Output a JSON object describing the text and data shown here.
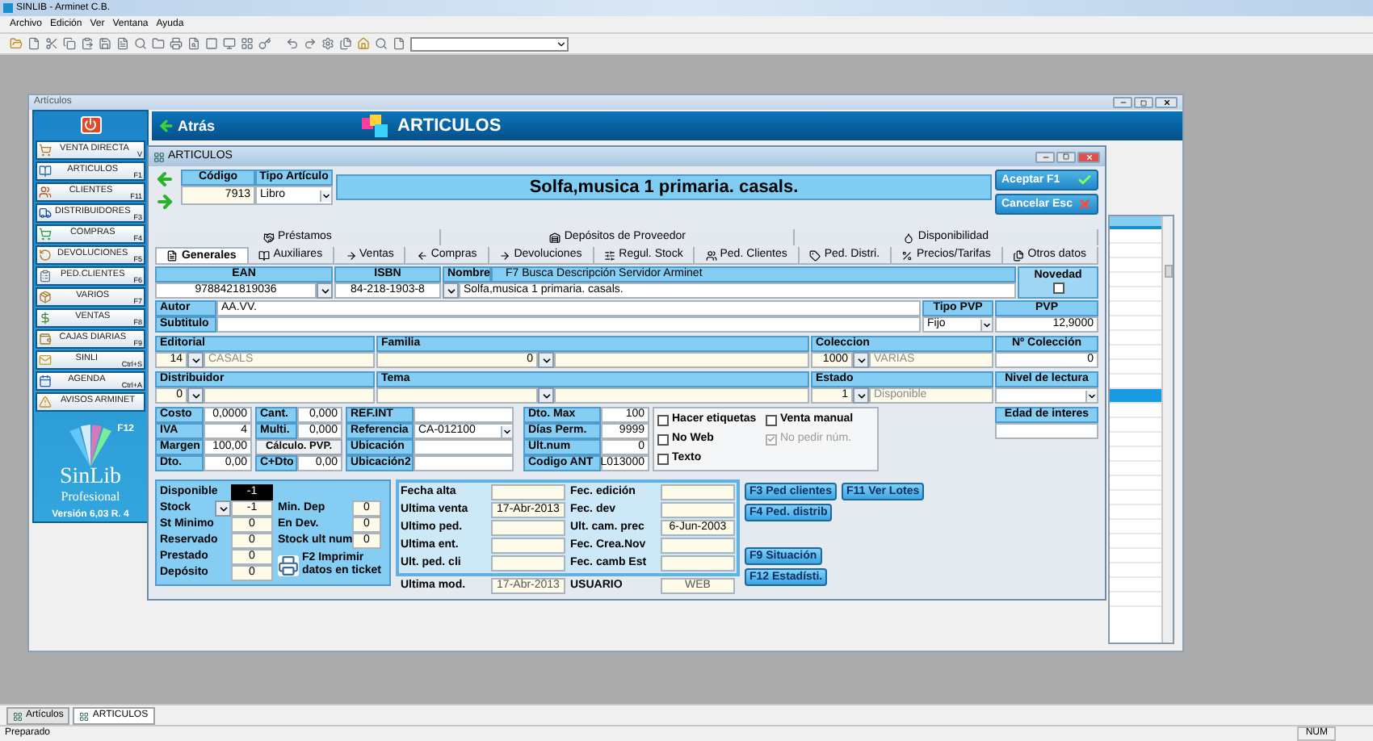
{
  "app": {
    "title": "SINLIB - Arminet C.B.",
    "menu": [
      "Archivo",
      "Edición",
      "Ver",
      "Ventana",
      "Ayuda"
    ]
  },
  "outer_window": {
    "title": "Artículos"
  },
  "sidebar": {
    "items": [
      {
        "label": "VENTA DIRECTA",
        "shortcut": "V"
      },
      {
        "label": "ARTICULOS",
        "shortcut": "F1"
      },
      {
        "label": "CLIENTES",
        "shortcut": "F11"
      },
      {
        "label": "DISTRIBUIDORES",
        "shortcut": "F3"
      },
      {
        "label": "COMPRAS",
        "shortcut": "F4"
      },
      {
        "label": "DEVOLUCIONES",
        "shortcut": "F5"
      },
      {
        "label": "PED.CLIENTES",
        "shortcut": "F6"
      },
      {
        "label": "VARIOS",
        "shortcut": "F7"
      },
      {
        "label": "VENTAS",
        "shortcut": "F8"
      },
      {
        "label": "CAJAS DIARIAS",
        "shortcut": "F9"
      },
      {
        "label": "SINLI",
        "shortcut": "Ctrl+S"
      },
      {
        "label": "AGENDA",
        "shortcut": "Ctrl+A"
      },
      {
        "label": "AVISOS ARMINET"
      }
    ],
    "brand": {
      "badge": "F12",
      "name": "SinLib",
      "edition": "Profesional",
      "version": "Versión 6,03 R. 4"
    }
  },
  "header": {
    "back": "Atrás",
    "title": "ARTICULOS"
  },
  "background_list": {
    "rows": [
      {
        "selected": false
      },
      {
        "selected": false
      },
      {
        "selected": false
      },
      {
        "selected": false
      },
      {
        "selected": false
      },
      {
        "selected": false
      },
      {
        "selected": false
      },
      {
        "selected": false
      },
      {
        "selected": false
      },
      {
        "selected": false
      },
      {
        "selected": false
      },
      {
        "selected": true
      },
      {
        "selected": false
      },
      {
        "selected": false
      },
      {
        "selected": false
      },
      {
        "selected": false
      },
      {
        "selected": false
      },
      {
        "selected": false
      },
      {
        "selected": false
      },
      {
        "selected": false
      },
      {
        "selected": false
      },
      {
        "selected": false
      },
      {
        "selected": false
      },
      {
        "selected": false
      },
      {
        "selected": false
      },
      {
        "selected": false
      }
    ]
  },
  "dialog": {
    "title": "ARTICULOS",
    "code": {
      "label": "Código",
      "value": "7913"
    },
    "type": {
      "label": "Tipo Artículo",
      "value": "Libro"
    },
    "banner": "Solfa,musica 1 primaria. casals.",
    "actions": [
      {
        "label": "Aceptar F1",
        "kind": "accept"
      },
      {
        "label": "Cancelar Esc",
        "kind": "cancel"
      }
    ],
    "tabs_upper": [
      {
        "label": "Préstamos",
        "selected": false
      },
      {
        "label": "Depósitos de Proveedor",
        "selected": false
      },
      {
        "label": "Disponibilidad",
        "selected": false
      }
    ],
    "tabs_lower": [
      {
        "label": "Generales",
        "selected": true
      },
      {
        "label": "Auxiliares",
        "selected": false
      },
      {
        "label": "Ventas",
        "selected": false
      },
      {
        "label": "Compras",
        "selected": false
      },
      {
        "label": "Devoluciones",
        "selected": false
      },
      {
        "label": "Regul. Stock",
        "selected": false
      },
      {
        "label": "Ped. Clientes",
        "selected": false
      },
      {
        "label": "Ped. Distri.",
        "selected": false
      },
      {
        "label": "Precios/Tarifas",
        "selected": false
      },
      {
        "label": "Otros datos",
        "selected": false
      }
    ],
    "ean": {
      "label": "EAN",
      "value": "9788421819036"
    },
    "isbn": {
      "label": "ISBN",
      "value": "84-218-1903-8"
    },
    "nombre": {
      "label": "Nombre",
      "hint": "F7 Busca Descripción Servidor Arminet",
      "value": "Solfa,musica 1 primaria. casals."
    },
    "novedad": {
      "label": "Novedad",
      "checked": false
    },
    "autor": {
      "label": "Autor",
      "value": "AA.VV."
    },
    "subtitulo": {
      "label": "Subtitulo"
    },
    "tipo_pvp": {
      "label": "Tipo PVP",
      "value": "Fijo"
    },
    "pvp": {
      "label": "PVP",
      "value": "12,9000"
    },
    "lookup_rows": [
      {
        "columns": [
          {
            "label": "Editorial",
            "kind": "lookup",
            "code": "14",
            "name": "CASALS"
          },
          {
            "label": "Familia",
            "kind": "lookup",
            "code": "0"
          },
          {
            "label": "Coleccion",
            "kind": "lookup",
            "code": "1000",
            "name": "VARIAS"
          },
          {
            "label": "Nº Colección",
            "kind": "number",
            "value": "0"
          }
        ]
      },
      {
        "columns": [
          {
            "label": "Distribuidor",
            "kind": "lookup",
            "code": "0"
          },
          {
            "label": "Tema",
            "kind": "lookup"
          },
          {
            "label": "Estado",
            "kind": "lookup",
            "code": "1",
            "name": "Disponible"
          },
          {
            "label": "Nivel de lectura",
            "kind": "dropdown"
          }
        ]
      }
    ],
    "pricing": [
      {
        "label": "Costo",
        "value": "0,0000"
      },
      {
        "label": "IVA",
        "value": "4"
      },
      {
        "label": "Margen",
        "value": "100,00"
      },
      {
        "label": "Dto.",
        "value": "0,00"
      }
    ],
    "quantities": [
      {
        "label": "Cant.",
        "kind": "field",
        "value": "0,000"
      },
      {
        "label": "Multi.",
        "kind": "field",
        "value": "0,000"
      },
      {
        "label": "Cálculo. PVP.",
        "kind": "button"
      },
      {
        "label": "C+Dto",
        "kind": "field",
        "value": "0,00"
      }
    ],
    "refs": [
      {
        "label": "REF.INT",
        "kind": "text"
      },
      {
        "label": "Referencia",
        "kind": "dropdown",
        "value": "CA-012100"
      },
      {
        "label": "Ubicación",
        "kind": "text"
      },
      {
        "label": "Ubicación2",
        "kind": "text"
      }
    ],
    "limits": [
      {
        "label": "Dto. Max",
        "value": "100"
      },
      {
        "label": "Días Perm.",
        "value": "9999"
      },
      {
        "label": "Ult.num",
        "value": "0"
      },
      {
        "label": "Codigo ANT",
        "value": "L013000"
      }
    ],
    "flags": [
      {
        "label": "Hacer etiquetas",
        "checked": false,
        "disabled": false
      },
      {
        "label": "No Web",
        "checked": false,
        "disabled": false
      },
      {
        "label": "Texto",
        "checked": false,
        "disabled": false
      },
      {
        "label": "Venta manual",
        "checked": false,
        "disabled": false
      },
      {
        "label": "No pedir núm.",
        "checked": true,
        "disabled": true
      }
    ],
    "edad": {
      "label": "Edad de interes"
    },
    "stock": [
      {
        "label": "Disponible",
        "kind": "highlight",
        "value": "-1"
      },
      {
        "label": "Stock",
        "kind": "lookup",
        "value": "-1"
      },
      {
        "label": "St Minimo",
        "kind": "plain",
        "value": "0"
      },
      {
        "label": "Reservado",
        "kind": "plain",
        "value": "0"
      },
      {
        "label": "Prestado",
        "kind": "plain",
        "value": "0"
      },
      {
        "label": "Depósito",
        "kind": "plain",
        "value": "0"
      }
    ],
    "stock_extra": [
      {
        "label": "Min. Dep",
        "value": "0"
      },
      {
        "label": "En Dev.",
        "value": "0"
      },
      {
        "label": "Stock ult num",
        "value": "0"
      }
    ],
    "print_button": "F2 Imprimir datos en ticket",
    "dates_left": [
      {
        "label": "Fecha alta"
      },
      {
        "label": "Ultima venta",
        "value": "17-Abr-2013"
      },
      {
        "label": "Ultimo ped."
      },
      {
        "label": "Ultima ent."
      },
      {
        "label": "Ult. ped. cli"
      }
    ],
    "dates_right": [
      {
        "label": "Fec. edición"
      },
      {
        "label": "Fec. dev"
      },
      {
        "label": "Ult. cam. prec",
        "value": "6-Jun-2003"
      },
      {
        "label": "Fec. Crea.Nov"
      },
      {
        "label": "Fec. camb Est"
      }
    ],
    "last_mod": {
      "label": "Ultima mod.",
      "value": "17-Abr-2013"
    },
    "user": {
      "label": "USUARIO",
      "value": "WEB"
    },
    "function_rows": [
      {
        "buttons": [
          "F3 Ped clientes",
          "F11 Ver Lotes"
        ]
      },
      {
        "buttons": [
          "F4 Ped. distrib"
        ]
      },
      {
        "buttons": [
          "F9 Situación"
        ]
      },
      {
        "buttons": [
          "F12 Estadísti."
        ]
      }
    ]
  },
  "taskbar": [
    {
      "label": "Artículos",
      "selected": false
    },
    {
      "label": "ARTICULOS",
      "selected": true
    }
  ],
  "status_bar": {
    "message": "Preparado",
    "indicator": "NUM"
  }
}
